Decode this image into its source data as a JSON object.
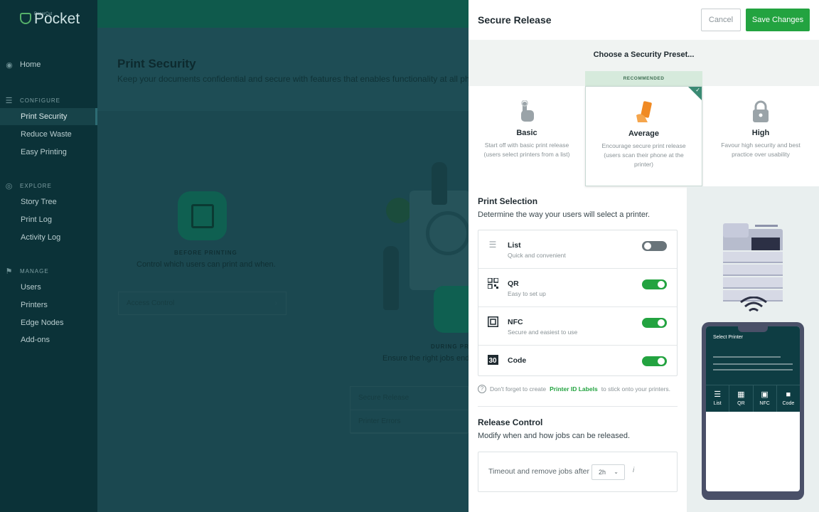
{
  "app": {
    "brand_small": "PaperCut",
    "brand": "Pocket"
  },
  "sidebar": {
    "home": "Home",
    "sections": [
      {
        "title": "CONFIGURE",
        "items": [
          "Print Security",
          "Reduce Waste",
          "Easy Printing"
        ]
      },
      {
        "title": "EXPLORE",
        "items": [
          "Story Tree",
          "Print Log",
          "Activity Log"
        ]
      },
      {
        "title": "MANAGE",
        "items": [
          "Users",
          "Printers",
          "Edge Nodes",
          "Add-ons"
        ]
      }
    ]
  },
  "page": {
    "title": "Print Security",
    "subtitle": "Keep your documents confidential and secure with features that enables functionality at all pha",
    "before_label": "BEFORE PRINTING",
    "before_desc": "Control which users can print and when.",
    "access_control": "Access Control",
    "during_label": "DURING PRI",
    "during_desc": "Ensure the right jobs end u",
    "secure_release": "Secure Release",
    "printer_errors": "Printer Errors"
  },
  "panel": {
    "title": "Secure Release",
    "cancel": "Cancel",
    "save": "Save Changes",
    "preset_heading": "Choose a Security Preset...",
    "recommended": "RECOMMENDED",
    "presets": [
      {
        "name": "Basic",
        "desc": "Start off with basic print release (users select printers from a list)"
      },
      {
        "name": "Average",
        "desc": "Encourage secure print release (users scan their phone at the printer)"
      },
      {
        "name": "High",
        "desc": "Favour high security and best practice over usability"
      }
    ],
    "print_selection_title": "Print Selection",
    "print_selection_sub": "Determine the way your users will select a printer.",
    "options": [
      {
        "name": "List",
        "desc": "Quick and convenient",
        "enabled": false
      },
      {
        "name": "QR",
        "desc": "Easy to set up",
        "enabled": true
      },
      {
        "name": "NFC",
        "desc": "Secure and easiest to use",
        "enabled": true
      },
      {
        "name": "Code",
        "desc": "",
        "enabled": true
      }
    ],
    "hint_pre": "Don't forget to create",
    "hint_link": "Printer ID Labels",
    "hint_post": "to stick onto your printers.",
    "release_title": "Release Control",
    "release_sub": "Modify when and how jobs can be released.",
    "timeout_label": "Timeout and remove jobs after",
    "timeout_value": "2h",
    "info_glyph": "i"
  },
  "phone": {
    "title": "Select Printer",
    "tabs": [
      "List",
      "QR",
      "NFC",
      "Code"
    ]
  },
  "colors": {
    "accent": "#23a340",
    "sidebar": "#0b3238",
    "teal_dark": "#0e3d43"
  }
}
